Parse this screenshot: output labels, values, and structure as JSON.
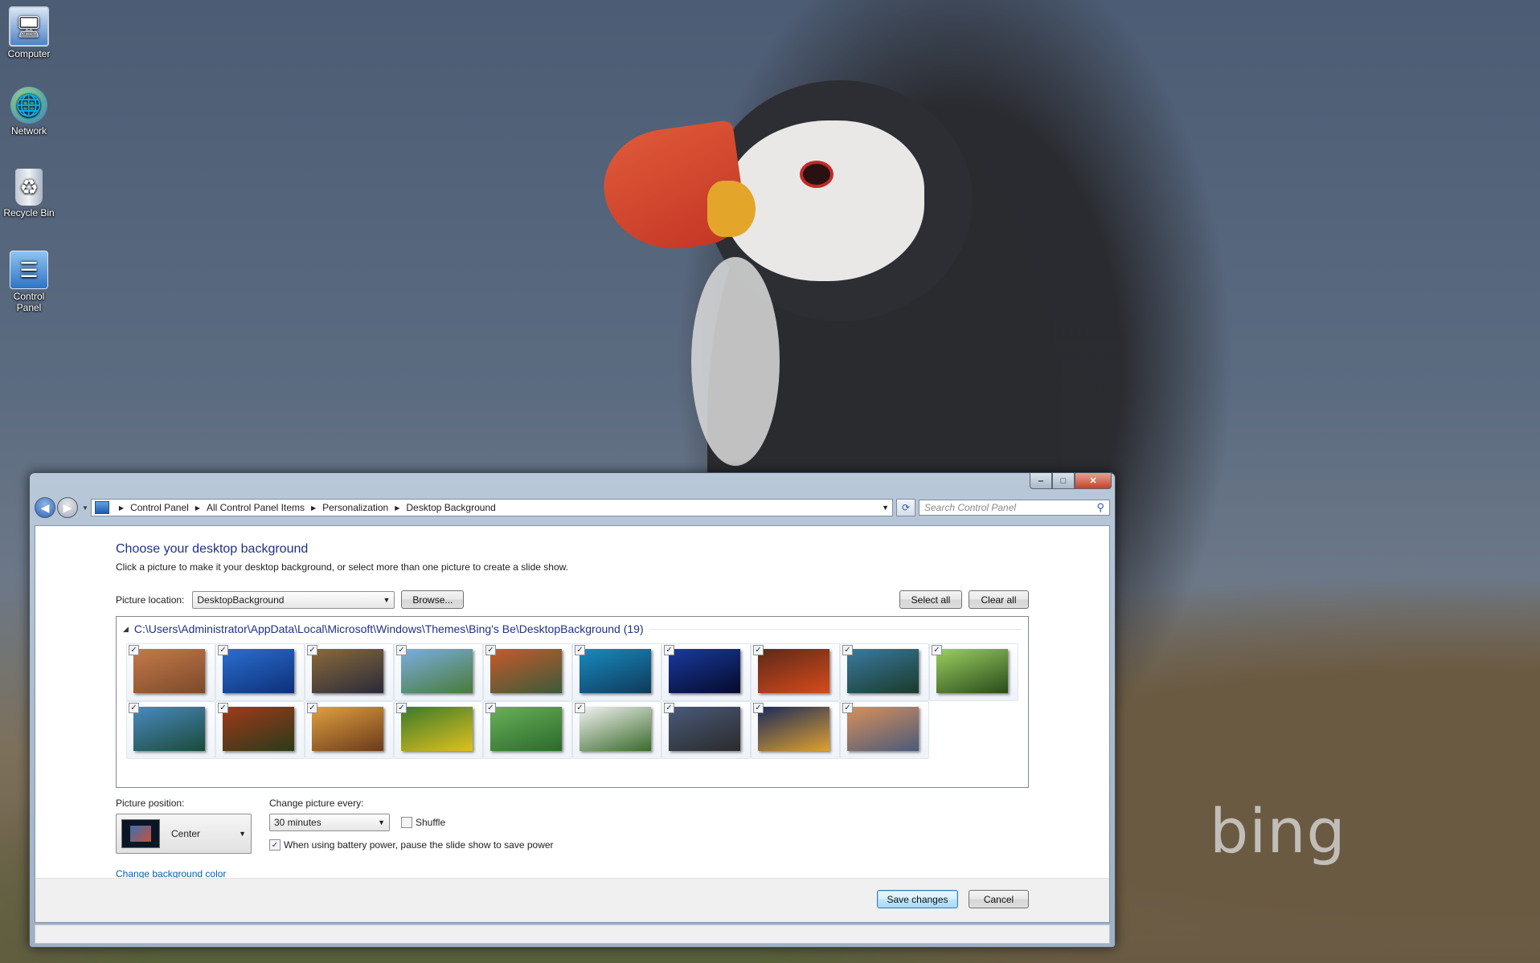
{
  "desktop": {
    "icons": [
      {
        "label": "Computer",
        "icon": "computer-icon"
      },
      {
        "label": "Network",
        "icon": "network-icon"
      },
      {
        "label": "Recycle Bin",
        "icon": "recycle-bin-icon"
      },
      {
        "label": "Control Panel",
        "icon": "control-panel-icon"
      }
    ],
    "watermark": "bing"
  },
  "window": {
    "caption_buttons": {
      "minimize": "‒",
      "maximize": "□",
      "close": "✕"
    },
    "breadcrumb": [
      "Control Panel",
      "All Control Panel Items",
      "Personalization",
      "Desktop Background"
    ],
    "search_placeholder": "Search Control Panel",
    "heading": "Choose your desktop background",
    "subtext": "Click a picture to make it your desktop background, or select more than one picture to create a slide show.",
    "picture_location": {
      "label": "Picture location:",
      "value": "DesktopBackground",
      "browse_label": "Browse...",
      "select_all_label": "Select all",
      "clear_all_label": "Clear all"
    },
    "group_header": "C:\\Users\\Administrator\\AppData\\Local\\Microsoft\\Windows\\Themes\\Bing's Be\\DesktopBackground (19)",
    "thumbnails": [
      {
        "checked": true,
        "colors": [
          "#c6794a",
          "#7a4a2a"
        ]
      },
      {
        "checked": true,
        "colors": [
          "#2a6fcf",
          "#0d2f7a"
        ]
      },
      {
        "checked": true,
        "colors": [
          "#8a6a3a",
          "#2a2a3a"
        ]
      },
      {
        "checked": true,
        "colors": [
          "#7aaee0",
          "#4a7a3a"
        ]
      },
      {
        "checked": true,
        "colors": [
          "#c85a2a",
          "#3a5a3a"
        ]
      },
      {
        "checked": true,
        "colors": [
          "#1a8ac0",
          "#0d3a5a"
        ]
      },
      {
        "checked": true,
        "colors": [
          "#1a3aa0",
          "#050a2a"
        ]
      },
      {
        "checked": true,
        "colors": [
          "#5a2a1a",
          "#d84a1a"
        ]
      },
      {
        "checked": true,
        "colors": [
          "#3a7aa0",
          "#1a3a2a"
        ]
      },
      {
        "checked": true,
        "colors": [
          "#9ad060",
          "#2a4a1a"
        ]
      },
      {
        "checked": true,
        "colors": [
          "#4a8ac0",
          "#1a4a3a"
        ]
      },
      {
        "checked": true,
        "colors": [
          "#a03a1a",
          "#2a3a1a"
        ]
      },
      {
        "checked": true,
        "colors": [
          "#e0a040",
          "#6a3a1a"
        ]
      },
      {
        "checked": true,
        "colors": [
          "#3a7a2a",
          "#e0c020"
        ]
      },
      {
        "checked": true,
        "colors": [
          "#6ab05a",
          "#2a6a2a"
        ]
      },
      {
        "checked": true,
        "colors": [
          "#f2f2f2",
          "#3a6a2a"
        ]
      },
      {
        "checked": true,
        "colors": [
          "#4a5a7a",
          "#2a2a2a"
        ]
      },
      {
        "checked": true,
        "colors": [
          "#1a2a5a",
          "#e0a030"
        ]
      },
      {
        "checked": true,
        "colors": [
          "#d8905a",
          "#4a5a7a"
        ]
      }
    ],
    "picture_position": {
      "label": "Picture position:",
      "value": "Center"
    },
    "change_picture": {
      "label": "Change picture every:",
      "value": "30 minutes"
    },
    "shuffle": {
      "label": "Shuffle",
      "checked": false
    },
    "battery": {
      "label": "When using battery power, pause the slide show to save power",
      "checked": true
    },
    "change_color_link": "Change background color",
    "save_label": "Save changes",
    "cancel_label": "Cancel"
  }
}
